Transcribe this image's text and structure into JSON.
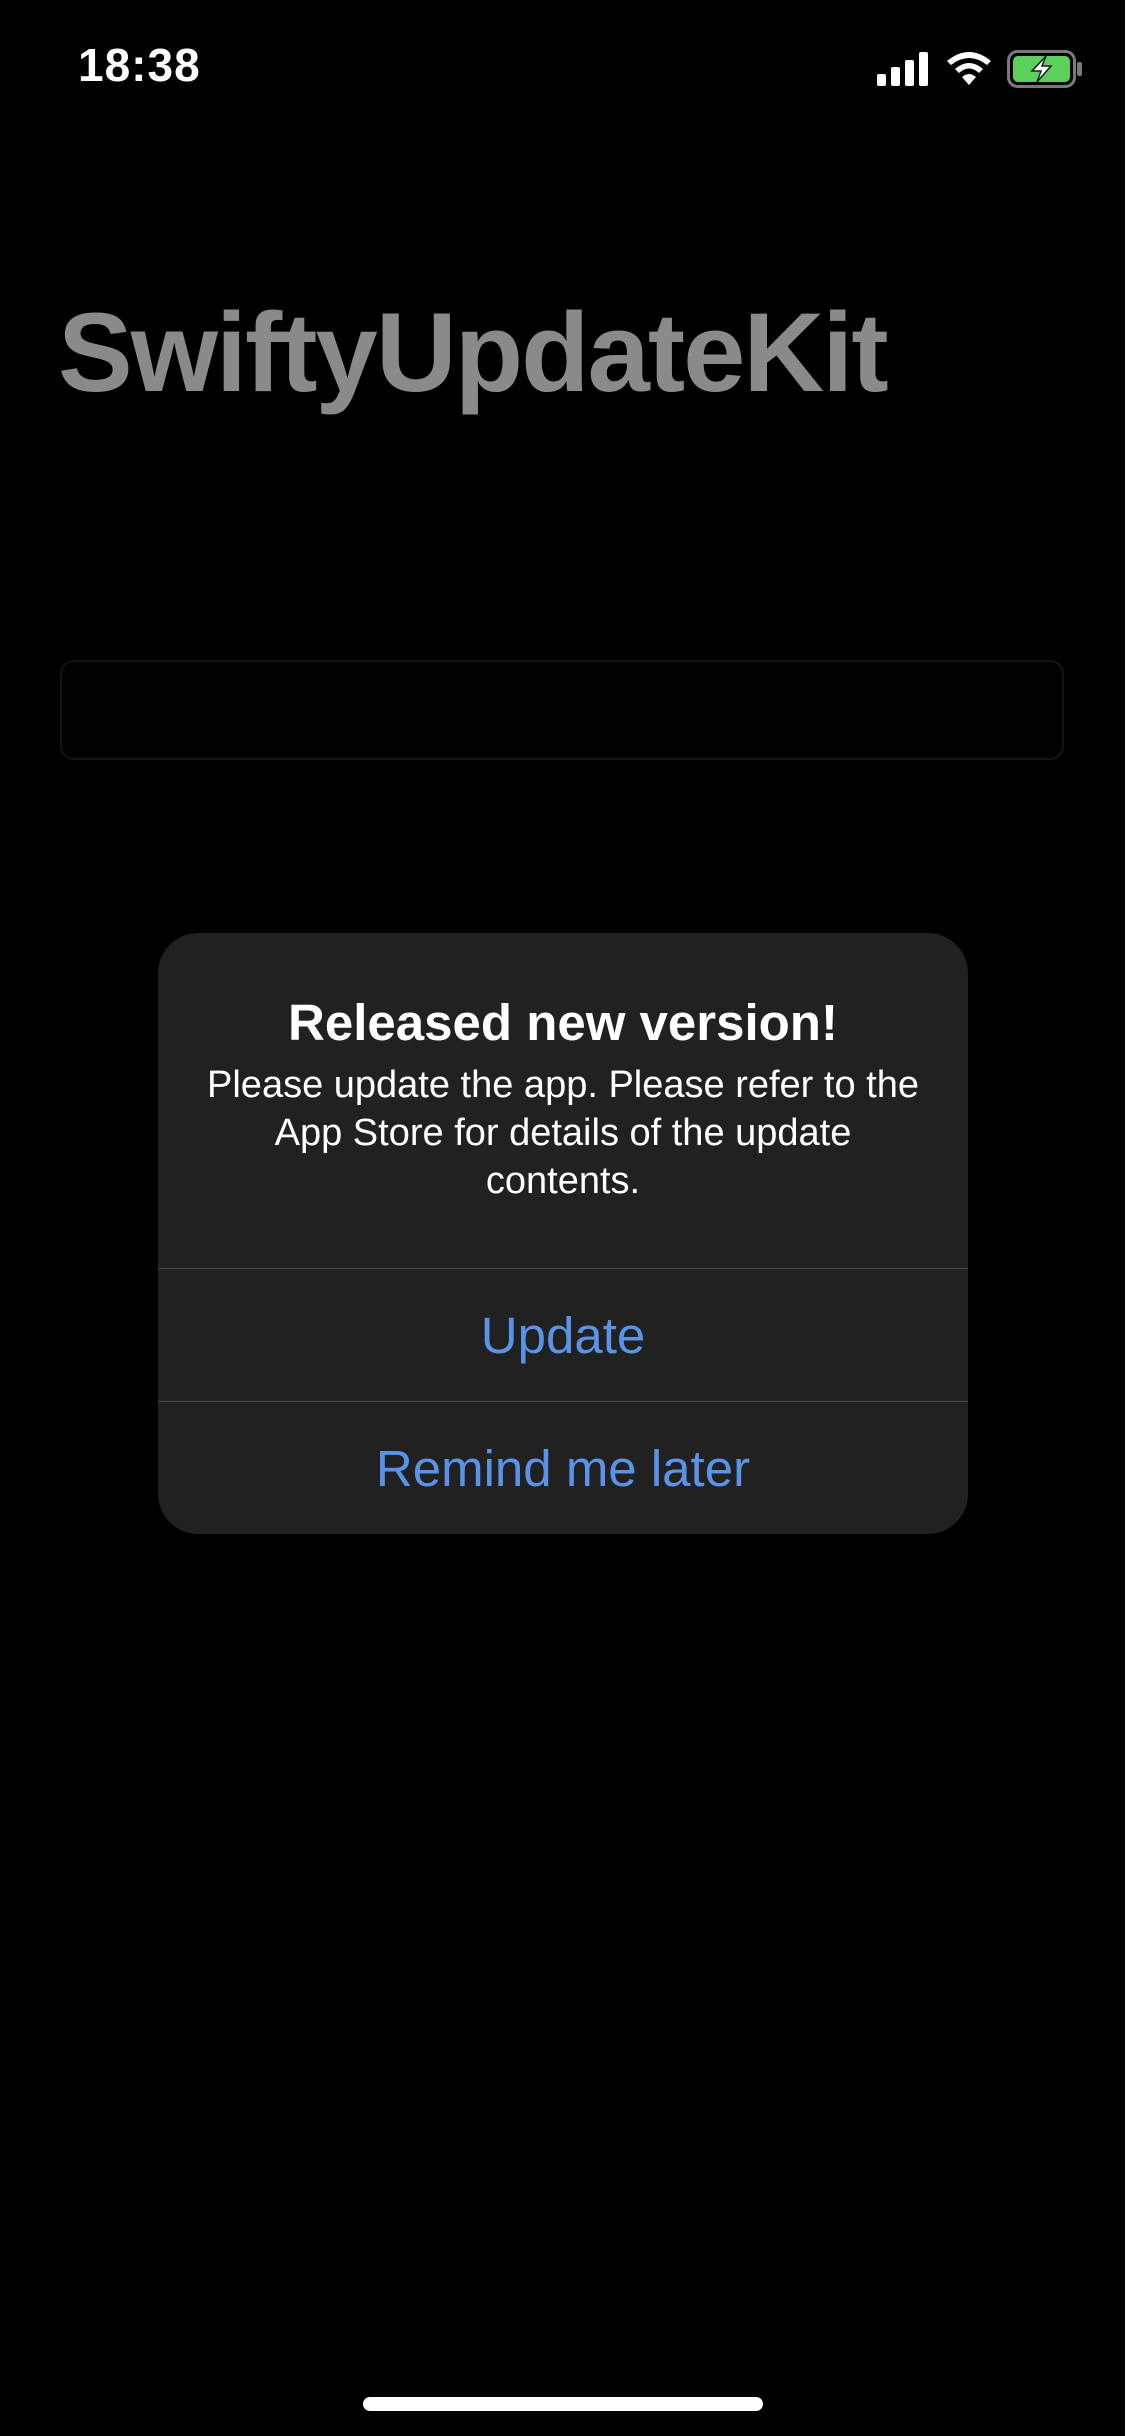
{
  "status_bar": {
    "time": "18:38",
    "icons": [
      "cellular-signal-icon",
      "wifi-icon",
      "battery-charging-icon"
    ],
    "battery_color": "#5bd05a"
  },
  "background": {
    "title": "SwiftyUpdateKit",
    "field_text": ""
  },
  "alert": {
    "title": "Released new version!",
    "message": "Please update the app. Please refer to the App Store for details of the update contents.",
    "buttons": {
      "update": "Update",
      "remind_later": "Remind me later"
    },
    "accent_color": "#5b93e8"
  }
}
